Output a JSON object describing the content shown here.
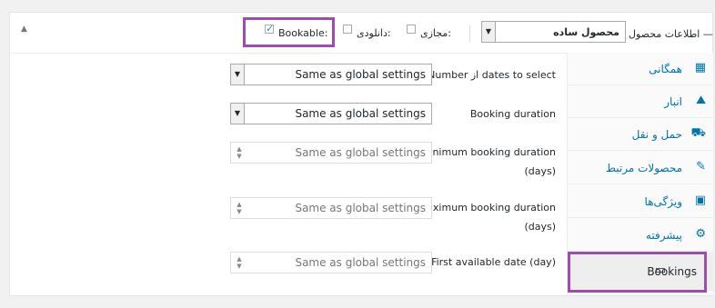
{
  "header": {
    "title": "اطلاعات محصول —",
    "product_type": "محصول ساده",
    "virtual_label": "مجازی:",
    "downloadable_label": "دانلودی:",
    "bookable_label": "Bookable:",
    "bookable_checked": "✓",
    "collapse_icon": "▲"
  },
  "tabs": [
    {
      "label": "همگانی",
      "icon": "▦"
    },
    {
      "label": "انبار",
      "icon": "⛰"
    },
    {
      "label": "حمل و نقل",
      "icon": "⛟"
    },
    {
      "label": "محصولات مرتبط",
      "icon": "✎"
    },
    {
      "label": "ویژگی‌ها",
      "icon": "▣"
    },
    {
      "label": "پیشرفته",
      "icon": "⚙"
    },
    {
      "label": "Bookings",
      "icon": "▭"
    }
  ],
  "fields": {
    "dates_to_select": {
      "label": "Number از dates to select",
      "value": "Same as global settings"
    },
    "booking_duration": {
      "label": "Booking duration",
      "value": "Same as global settings"
    },
    "min_duration": {
      "label_line1": "Minimum booking duration",
      "label_line2": "(days)",
      "placeholder": "Same as global settings"
    },
    "max_duration": {
      "label_line1": "Maximum booking duration",
      "label_line2": "(days)",
      "placeholder": "Same as global settings"
    },
    "first_available": {
      "label": "First available date (day)",
      "placeholder": "Same as global settings"
    }
  },
  "colors": {
    "highlight": "#9b4fab",
    "link": "#0073aa"
  }
}
